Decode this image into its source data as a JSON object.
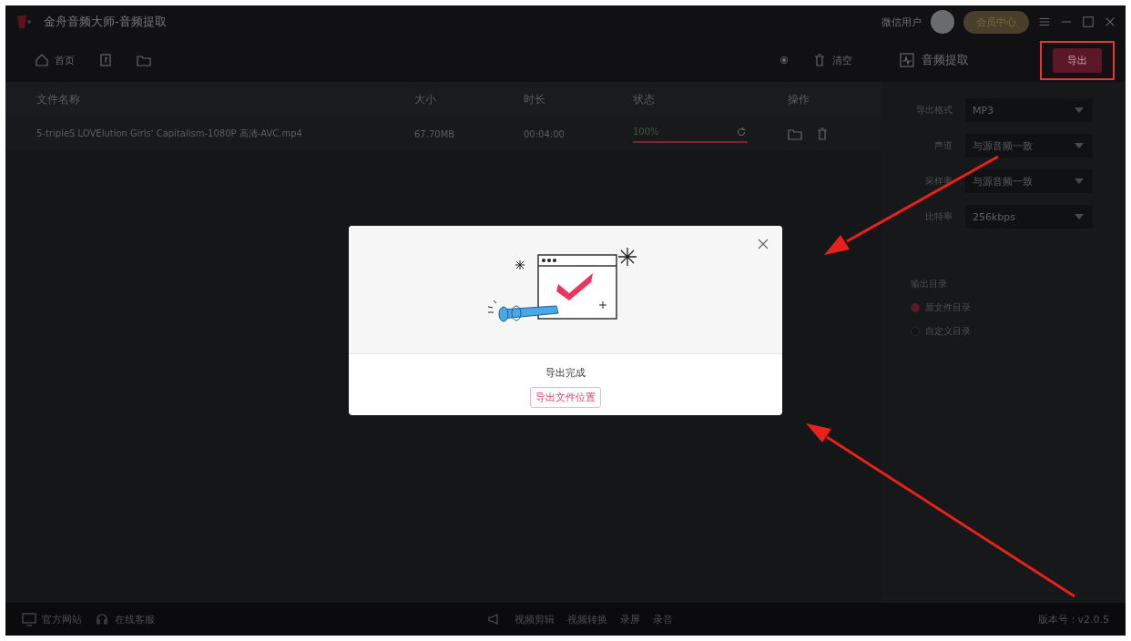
{
  "window": {
    "title": "金舟音频大师-音频提取"
  },
  "header": {
    "user": "微信用户",
    "vip_button": "会员中心"
  },
  "toolbar": {
    "home": "首页",
    "clear": "清空"
  },
  "table": {
    "columns": [
      "文件名称",
      "大小",
      "时长",
      "状态",
      "操作"
    ],
    "rows": [
      {
        "name": "5-tripleS LOVElution Girls' Capitalism-1080P 高清-AVC.mp4",
        "size": "67.70MB",
        "duration": "00:04:00",
        "status": "100%",
        "level": 1
      }
    ]
  },
  "panel": {
    "title": "音频提取",
    "export_button": "导出",
    "settings": [
      {
        "label": "导出格式",
        "value": "MP3"
      },
      {
        "label": "声道",
        "value": "与源音频一致"
      },
      {
        "label": "采样率",
        "value": "与源音频一致"
      },
      {
        "label": "比特率",
        "value": "256kbps"
      }
    ],
    "output": {
      "title": "输出目录",
      "options": [
        {
          "label": "原文件目录",
          "selected": true
        },
        {
          "label": "自定义目录",
          "selected": false
        }
      ]
    }
  },
  "footer": {
    "links": [
      "官方网站",
      "在线客服"
    ],
    "tools": [
      "视频剪辑",
      "视频转换",
      "录屏",
      "录音"
    ],
    "version": "版本号：v2.0.5"
  },
  "dialog": {
    "message": "导出完成",
    "button": "导出文件位置"
  }
}
